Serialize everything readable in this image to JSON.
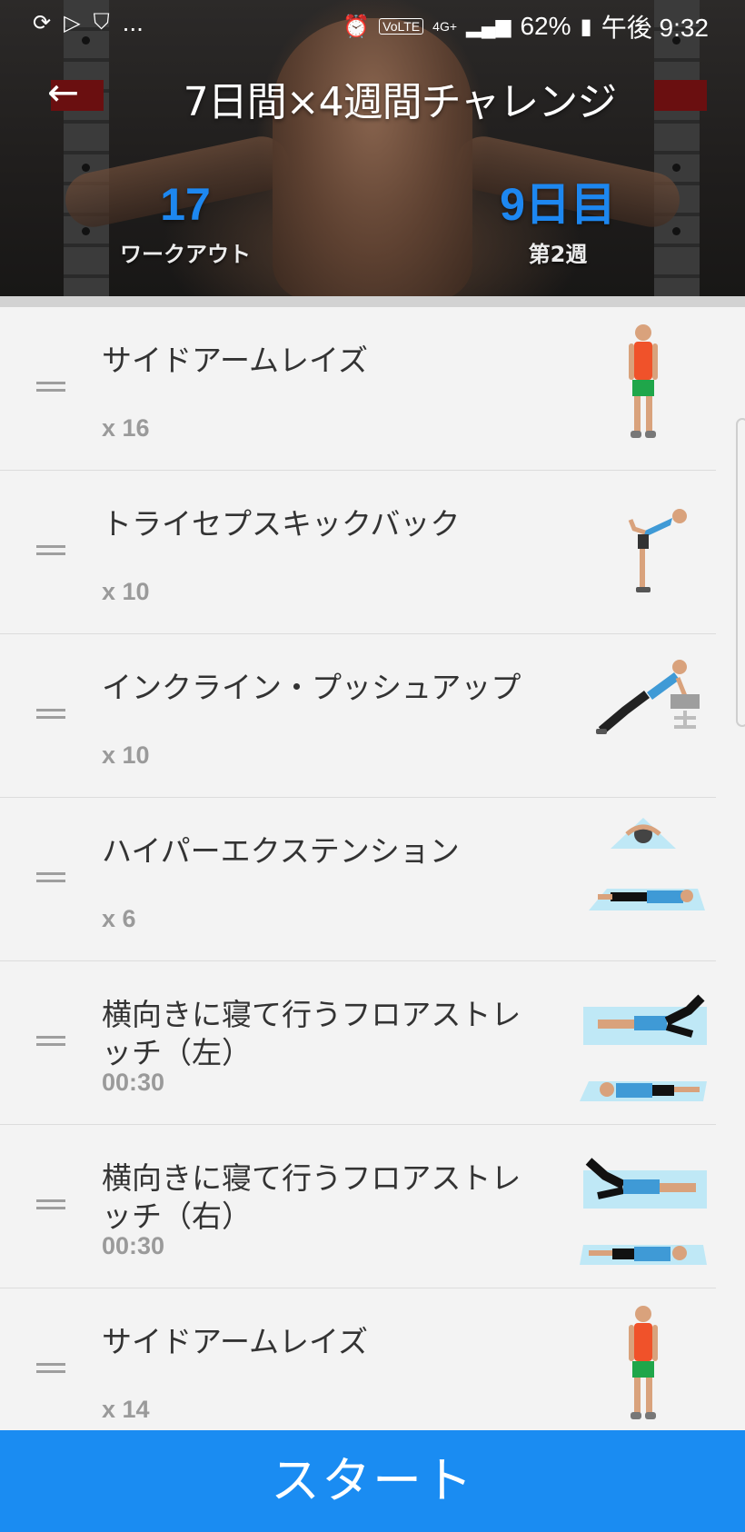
{
  "status_bar": {
    "left_icons": [
      "sync-icon",
      "play-store-icon",
      "shield-icon"
    ],
    "more": "...",
    "alarm_icon": "alarm-icon",
    "volte": "VoLTE",
    "network": "4G+",
    "battery_percent": "62%",
    "time": "午後 9:32"
  },
  "header": {
    "back_icon": "back-arrow-icon",
    "title": "7日間×4週間チャレンジ",
    "workouts_value": "17",
    "workouts_label": "ワークアウト",
    "day_value": "9日目",
    "week_label": "第2週"
  },
  "exercises": [
    {
      "name": "サイドアームレイズ",
      "value": "x 16",
      "figure": "side-arm-raise"
    },
    {
      "name": "トライセプスキックバック",
      "value": "x 10",
      "figure": "triceps-kickback"
    },
    {
      "name": "インクライン・プッシュアップ",
      "value": "x 10",
      "figure": "incline-pushup"
    },
    {
      "name": "ハイパーエクステンション",
      "value": "x 6",
      "figure": "hyperextension"
    },
    {
      "name": "横向きに寝て行うフロアストレッチ（左）",
      "value": "00:30",
      "figure": "side-floor-stretch-left"
    },
    {
      "name": "横向きに寝て行うフロアストレッチ（右）",
      "value": "00:30",
      "figure": "side-floor-stretch-right"
    },
    {
      "name": "サイドアームレイズ",
      "value": "x 14",
      "figure": "side-arm-raise"
    }
  ],
  "start_button": "スタート",
  "colors": {
    "accent": "#1a8cf2",
    "stat_blue": "#1d87f0",
    "list_bg": "#f3f3f3"
  }
}
